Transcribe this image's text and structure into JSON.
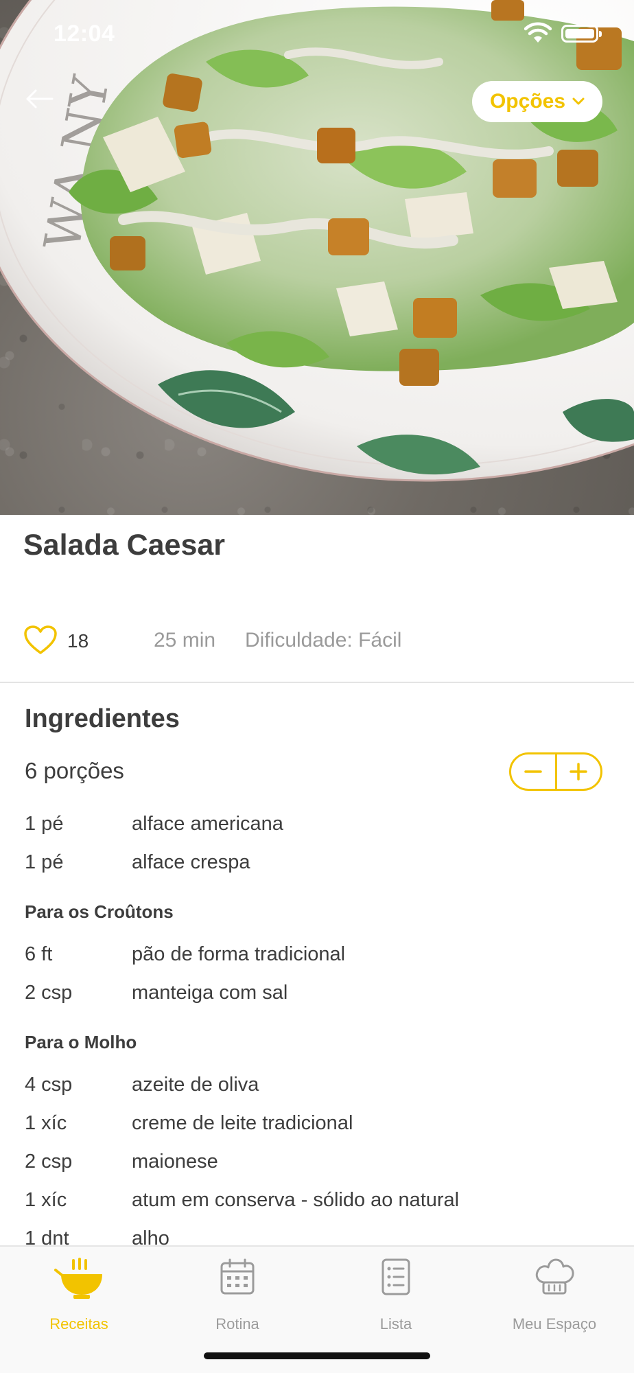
{
  "status_bar": {
    "time": "12:04"
  },
  "header": {
    "options_label": "Opções"
  },
  "recipe": {
    "title": "Salada Caesar",
    "likes": "18",
    "time": "25 min",
    "difficulty": "Dificuldade: Fácil"
  },
  "ingredients": {
    "title": "Ingredientes",
    "portions": "6 porções",
    "main": [
      {
        "qty": "1 pé",
        "name": "alface americana"
      },
      {
        "qty": "1 pé",
        "name": "alface crespa"
      }
    ],
    "croutons": {
      "title": "Para os Croûtons",
      "items": [
        {
          "qty": "6 ft",
          "name": "pão de forma tradicional"
        },
        {
          "qty": "2 csp",
          "name": "manteiga com sal"
        }
      ]
    },
    "sauce": {
      "title": "Para o Molho",
      "items": [
        {
          "qty": "4 csp",
          "name": "azeite de oliva"
        },
        {
          "qty": "1 xíc",
          "name": "creme de leite tradicional"
        },
        {
          "qty": "2 csp",
          "name": "maionese"
        },
        {
          "qty": "1 xíc",
          "name": "atum em conserva - sólido ao natural"
        },
        {
          "qty": "1 dnt",
          "name": "alho"
        }
      ]
    }
  },
  "tabs": [
    {
      "label": "Receitas",
      "icon": "bowl-icon",
      "active": true
    },
    {
      "label": "Rotina",
      "icon": "calendar-icon",
      "active": false
    },
    {
      "label": "Lista",
      "icon": "list-icon",
      "active": false
    },
    {
      "label": "Meu Espaço",
      "icon": "chef-hat-icon",
      "active": false
    }
  ],
  "colors": {
    "accent": "#f2c300",
    "text": "#3d3d3d",
    "muted": "#9a9a9a"
  }
}
